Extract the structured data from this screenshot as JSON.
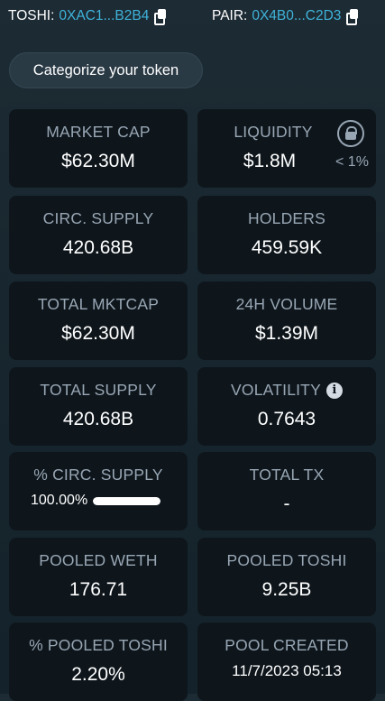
{
  "header": {
    "token_label": "TOSHI:",
    "token_address": "0XAC1...B2B4",
    "pair_label": "PAIR:",
    "pair_address": "0X4B0...C2D3"
  },
  "categorize_button": "Categorize your token",
  "stats": {
    "market_cap": {
      "label": "MARKET CAP",
      "value": "$62.30M"
    },
    "liquidity": {
      "label": "LIQUIDITY",
      "value": "$1.8M",
      "locked_pct": "< 1%"
    },
    "circ_supply": {
      "label": "CIRC. SUPPLY",
      "value": "420.68B"
    },
    "holders": {
      "label": "HOLDERS",
      "value": "459.59K"
    },
    "total_mktcap": {
      "label": "TOTAL MKTCAP",
      "value": "$62.30M"
    },
    "volume_24h": {
      "label": "24H VOLUME",
      "value": "$1.39M"
    },
    "total_supply": {
      "label": "TOTAL SUPPLY",
      "value": "420.68B"
    },
    "volatility": {
      "label": "VOLATILITY",
      "value": "0.7643"
    },
    "pct_circ_supply": {
      "label": "% CIRC. SUPPLY",
      "value": "100.00%",
      "progress_fraction": 1.0
    },
    "total_tx": {
      "label": "TOTAL TX",
      "value": "-"
    },
    "pooled_weth": {
      "label": "POOLED WETH",
      "value": "176.71"
    },
    "pooled_toshi": {
      "label": "POOLED TOSHI",
      "value": "9.25B"
    },
    "pct_pooled_toshi": {
      "label": "% POOLED TOSHI",
      "value": "2.20%"
    },
    "pool_created": {
      "label": "POOL CREATED",
      "value": "11/7/2023 05:13"
    }
  },
  "icons": {
    "copy": "copy-icon",
    "lock": "lock-icon",
    "info": "info-icon"
  },
  "colors": {
    "accent": "#3fb3da",
    "card_bg": "#0e161c",
    "label": "#98a6b4",
    "background": "#1b2a33"
  }
}
